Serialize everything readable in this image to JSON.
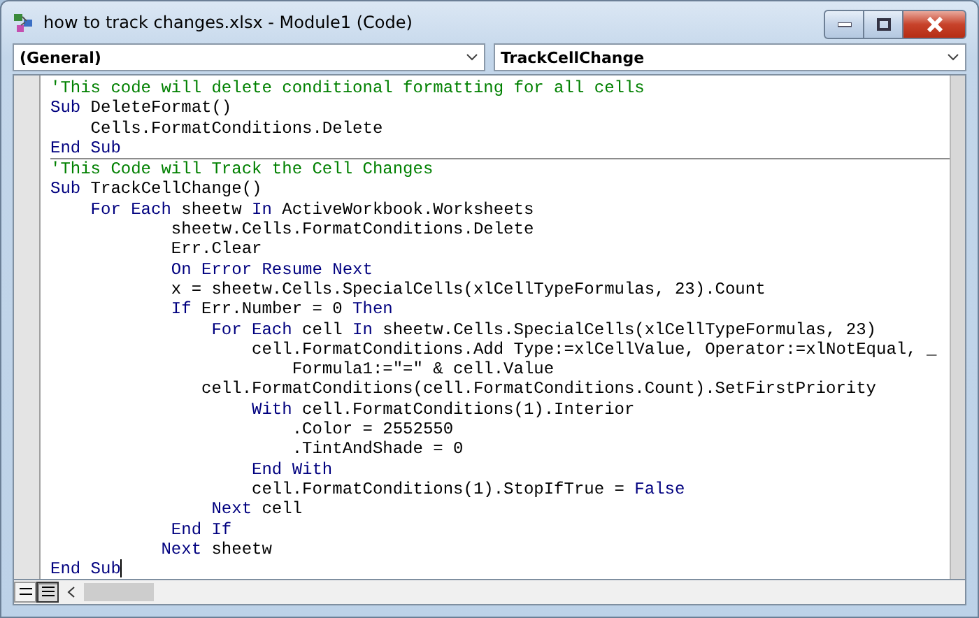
{
  "window": {
    "title": "how to track changes.xlsx - Module1 (Code)"
  },
  "object_dropdown": {
    "value": "(General)"
  },
  "procedure_dropdown": {
    "value": "TrackCellChange"
  },
  "procedures": [
    {
      "lines": [
        [
          {
            "kind": "comment",
            "text": "'This code will delete conditional formatting for all cells"
          }
        ],
        [
          {
            "kind": "keyword",
            "text": "Sub"
          },
          {
            "kind": "plain",
            "text": " DeleteFormat()"
          }
        ],
        [
          {
            "kind": "plain",
            "text": "    Cells.FormatConditions.Delete"
          }
        ],
        [
          {
            "kind": "keyword",
            "text": "End Sub"
          }
        ]
      ]
    },
    {
      "lines": [
        [
          {
            "kind": "comment",
            "text": "'This Code will Track the Cell Changes"
          }
        ],
        [
          {
            "kind": "keyword",
            "text": "Sub"
          },
          {
            "kind": "plain",
            "text": " TrackCellChange()"
          }
        ],
        [
          {
            "kind": "keyword",
            "text": "    For Each"
          },
          {
            "kind": "plain",
            "text": " sheetw "
          },
          {
            "kind": "keyword",
            "text": "In"
          },
          {
            "kind": "plain",
            "text": " ActiveWorkbook.Worksheets"
          }
        ],
        [
          {
            "kind": "plain",
            "text": "            sheetw.Cells.FormatConditions.Delete"
          }
        ],
        [
          {
            "kind": "plain",
            "text": "            Err.Clear"
          }
        ],
        [
          {
            "kind": "keyword",
            "text": "            On Error Resume Next"
          }
        ],
        [
          {
            "kind": "plain",
            "text": "            x = sheetw.Cells.SpecialCells(xlCellTypeFormulas, 23).Count"
          }
        ],
        [
          {
            "kind": "keyword",
            "text": "            If"
          },
          {
            "kind": "plain",
            "text": " Err.Number = 0 "
          },
          {
            "kind": "keyword",
            "text": "Then"
          }
        ],
        [
          {
            "kind": "keyword",
            "text": "                For Each"
          },
          {
            "kind": "plain",
            "text": " cell "
          },
          {
            "kind": "keyword",
            "text": "In"
          },
          {
            "kind": "plain",
            "text": " sheetw.Cells.SpecialCells(xlCellTypeFormulas, 23)"
          }
        ],
        [
          {
            "kind": "plain",
            "text": "                    cell.FormatConditions.Add Type:=xlCellValue, Operator:=xlNotEqual, _"
          }
        ],
        [
          {
            "kind": "plain",
            "text": "                        Formula1:=\"=\" & cell.Value"
          }
        ],
        [
          {
            "kind": "plain",
            "text": "               cell.FormatConditions(cell.FormatConditions.Count).SetFirstPriority"
          }
        ],
        [
          {
            "kind": "keyword",
            "text": "                    With"
          },
          {
            "kind": "plain",
            "text": " cell.FormatConditions(1).Interior"
          }
        ],
        [
          {
            "kind": "plain",
            "text": "                        .Color = 2552550"
          }
        ],
        [
          {
            "kind": "plain",
            "text": "                        .TintAndShade = 0"
          }
        ],
        [
          {
            "kind": "keyword",
            "text": "                    End With"
          }
        ],
        [
          {
            "kind": "plain",
            "text": "                    cell.FormatConditions(1).StopIfTrue = "
          },
          {
            "kind": "keyword",
            "text": "False"
          }
        ],
        [
          {
            "kind": "keyword",
            "text": "                Next"
          },
          {
            "kind": "plain",
            "text": " cell"
          }
        ],
        [
          {
            "kind": "keyword",
            "text": "            End If"
          }
        ],
        [
          {
            "kind": "keyword",
            "text": "           Next"
          },
          {
            "kind": "plain",
            "text": " sheetw"
          }
        ],
        [
          {
            "kind": "keyword",
            "text": "End Sub"
          }
        ]
      ]
    }
  ],
  "view_buttons": [
    {
      "kind": "procedure",
      "selected": false
    },
    {
      "kind": "module",
      "selected": true
    }
  ]
}
